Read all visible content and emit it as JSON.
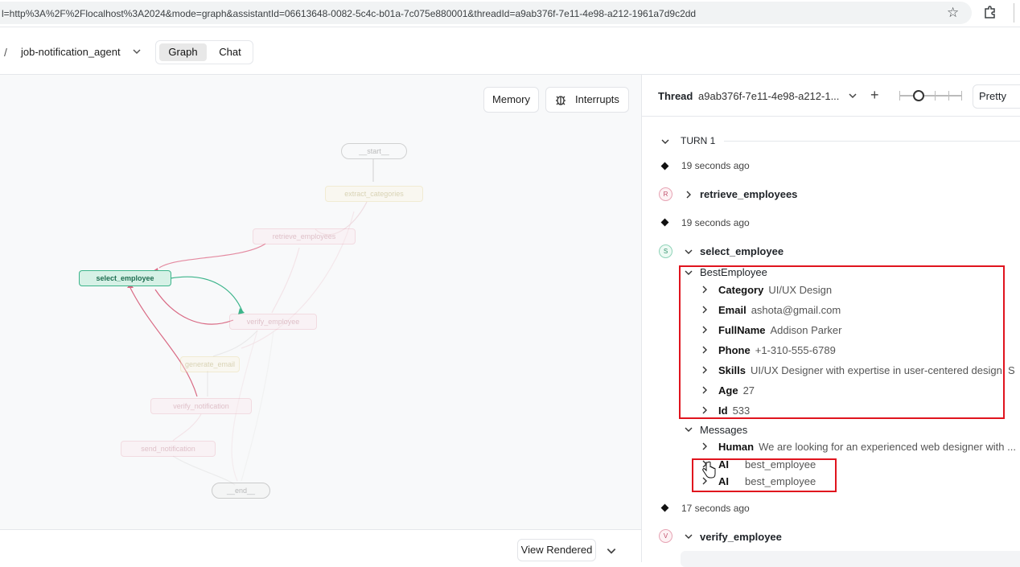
{
  "browser": {
    "url": "l=http%3A%2F%2Flocalhost%3A2024&mode=graph&assistantId=06613648-0082-5c4c-b01a-7c075e880001&threadId=a9ab376f-7e11-4e98-a212-1961a7d9c2dd"
  },
  "header": {
    "separator": "/",
    "agent_name": "job-notification_agent",
    "tabs": {
      "graph": "Graph",
      "chat": "Chat"
    }
  },
  "graph": {
    "memory_button": "Memory",
    "interrupts_button": "Interrupts",
    "view_rendered": "View Rendered",
    "nodes": {
      "start": "__start__",
      "extract_categories": "extract_categories",
      "retrieve_employees": "retrieve_employees",
      "select_employee": "select_employee",
      "verify_employee": "verify_employee",
      "generate_email": "generate_email",
      "verify_notification": "verify_notification",
      "send_notification": "send_notification",
      "end": "__end__"
    }
  },
  "thread": {
    "label": "Thread",
    "id": "a9ab376f-7e11-4e98-a212-1...",
    "view_mode": "Pretty",
    "turn": "TURN 1",
    "events": [
      {
        "time": "19 seconds ago",
        "badge": "R",
        "name": "retrieve_employees"
      },
      {
        "time": "19 seconds ago",
        "badge": "S",
        "name": "select_employee"
      },
      {
        "time": "17 seconds ago",
        "badge": "V",
        "name": "verify_employee"
      }
    ],
    "best_employee": {
      "title": "BestEmployee",
      "fields": [
        {
          "key": "Category",
          "value": "UI/UX Design"
        },
        {
          "key": "Email",
          "value": "ashota@gmail.com"
        },
        {
          "key": "FullName",
          "value": "Addison Parker"
        },
        {
          "key": "Phone",
          "value": "+1-310-555-6789"
        },
        {
          "key": "Skills",
          "value": "UI/UX Designer with expertise in user-centered design. S"
        },
        {
          "key": "Age",
          "value": "27"
        },
        {
          "key": "Id",
          "value": "533"
        }
      ]
    },
    "messages": {
      "title": "Messages",
      "items": [
        {
          "role": "Human",
          "content": "We are looking for an experienced web designer with ..."
        },
        {
          "role": "AI",
          "content": "best_employee"
        },
        {
          "role": "AI",
          "content": "best_employee"
        }
      ]
    }
  }
}
